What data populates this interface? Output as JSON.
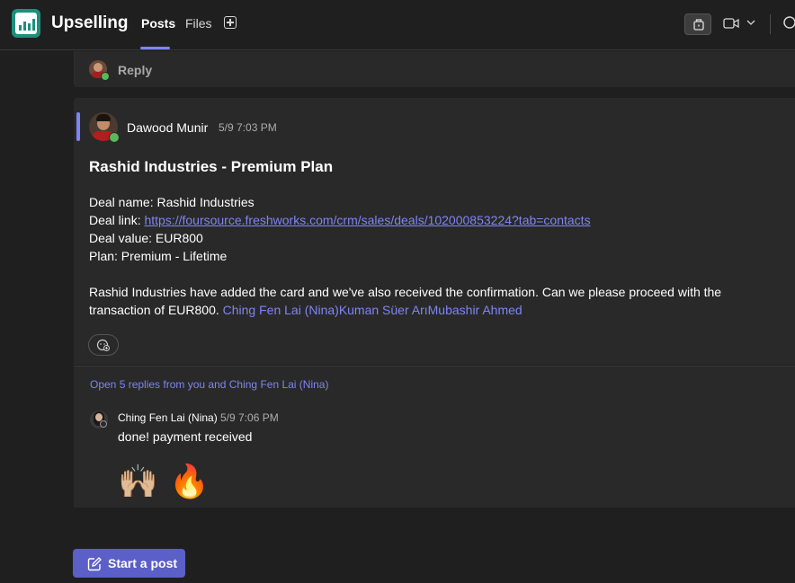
{
  "header": {
    "team_name": "Upselling",
    "tabs": [
      {
        "label": "Posts",
        "active": true
      },
      {
        "label": "Files",
        "active": false
      }
    ]
  },
  "reply_strip": {
    "label": "Reply"
  },
  "post": {
    "author": "Dawood Munir",
    "timestamp": "5/9 7:03 PM",
    "title": "Rashid Industries - Premium Plan",
    "deal_name_line": "Deal name: Rashid Industries",
    "deal_link_prefix": "Deal link: ",
    "deal_link_url": "https://foursource.freshworks.com/crm/sales/deals/102000853224?tab=contacts",
    "deal_value_line": "Deal value: EUR800",
    "plan_line": "Plan: Premium - Lifetime",
    "body_line1": "Rashid Industries have added the card and we've also received the confirmation. Can we please proceed with the",
    "body_line2_prefix": "transaction of EUR800. ",
    "mentions": "Ching Fen Lai (Nina)Kuman Süer ArıMubashir Ahmed"
  },
  "thread": {
    "open_replies_label": "Open 5 replies from you and Ching Fen Lai (Nina)",
    "reply": {
      "author": "Ching Fen Lai (Nina)",
      "timestamp": "5/9 7:06 PM",
      "text": "done! payment received",
      "emojis": [
        "🙌🏼",
        "🔥"
      ]
    }
  },
  "footer": {
    "start_post_label": "Start a post"
  },
  "colors": {
    "accent": "#7f85f5",
    "primary_button": "#5b5fc7",
    "team_logo": "#1d8f7c"
  }
}
